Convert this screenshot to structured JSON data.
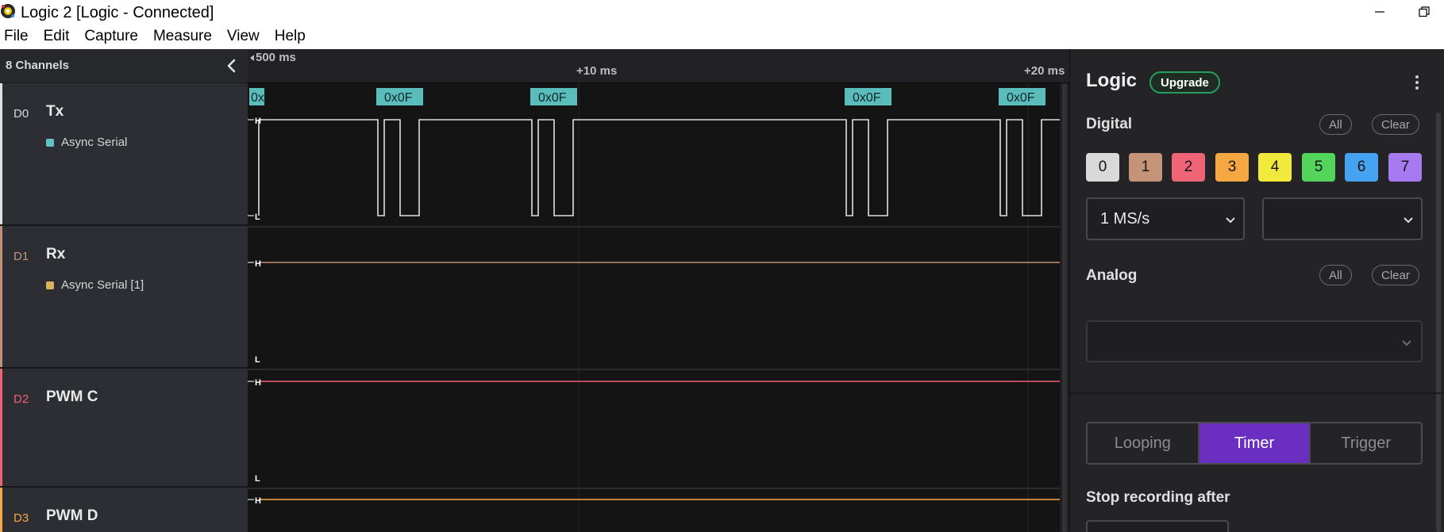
{
  "window": {
    "title": "Logic 2 [Logic - Connected]",
    "icons": {
      "app": "saleae-logo-icon",
      "minimize": "minimize-icon",
      "restore": "restore-window-icon"
    }
  },
  "menu": [
    "File",
    "Edit",
    "Capture",
    "Measure",
    "View",
    "Help"
  ],
  "channels_panel": {
    "title": "8 Channels",
    "collapse_icon": "chevron-left-icon",
    "rows": [
      {
        "id": "D0",
        "name": "Tx",
        "analyzer": "Async Serial",
        "accent": "#e0e0e0",
        "analyzer_color": "#5fc3c3",
        "id_color": "#d8d8d8"
      },
      {
        "id": "D1",
        "name": "Rx",
        "analyzer": "Async Serial [1]",
        "accent": "#c29276",
        "analyzer_color": "#d8b35c",
        "id_color": "#c9967b"
      },
      {
        "id": "D2",
        "name": "PWM C",
        "accent": "#ef6075",
        "id_color": "#ef6075"
      },
      {
        "id": "D3",
        "name": "PWM D",
        "accent": "#f5a742",
        "id_color": "#f5a742"
      }
    ]
  },
  "timeline": {
    "start_label": "500 ms",
    "tick_labels": [
      "+10 ms",
      "+20 ms"
    ],
    "level_high": "H",
    "level_low": "L",
    "decoded_frames": [
      "0x",
      "0x0F",
      "0x0F",
      "0x0F",
      "0x0F"
    ]
  },
  "panel": {
    "title": "Logic",
    "upgrade": "Upgrade",
    "more_icon": "kebab-menu-icon",
    "digital": {
      "label": "Digital",
      "all": "All",
      "clear": "Clear",
      "channels": [
        {
          "label": "0",
          "color": "#d9d9d9"
        },
        {
          "label": "1",
          "color": "#c59478"
        },
        {
          "label": "2",
          "color": "#f06478"
        },
        {
          "label": "3",
          "color": "#f5a742"
        },
        {
          "label": "4",
          "color": "#f1ea3c"
        },
        {
          "label": "5",
          "color": "#53d45b"
        },
        {
          "label": "6",
          "color": "#46a3f2"
        },
        {
          "label": "7",
          "color": "#a87af2"
        }
      ],
      "sample_rate": "1 MS/s",
      "voltage_value": ""
    },
    "analog": {
      "label": "Analog",
      "all": "All",
      "clear": "Clear",
      "rate_value": ""
    },
    "modes": {
      "looping": "Looping",
      "timer": "Timer",
      "trigger": "Trigger",
      "active": "Timer"
    },
    "stop_label": "Stop recording after"
  }
}
